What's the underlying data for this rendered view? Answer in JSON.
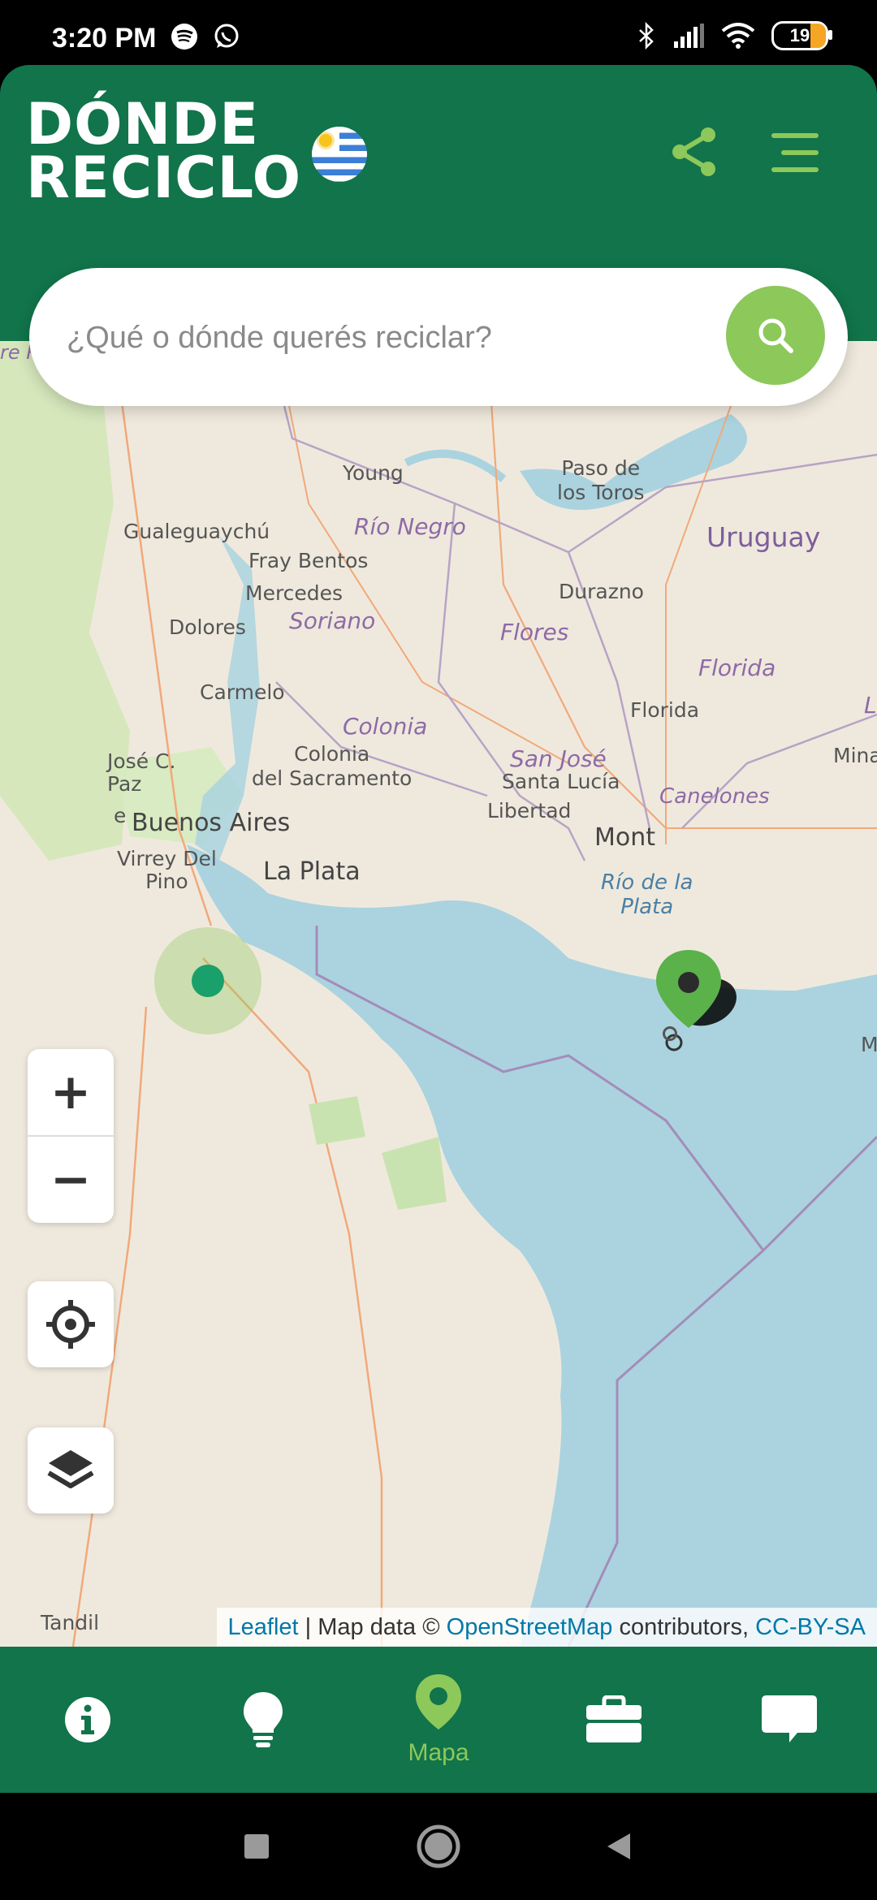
{
  "status_bar": {
    "time": "3:20 PM",
    "battery_level": "19",
    "icons": [
      "spotify-icon",
      "whatsapp-icon",
      "bluetooth-icon",
      "signal-icon",
      "wifi-icon",
      "battery-icon"
    ]
  },
  "header": {
    "brand_line1": "DÓNDE",
    "brand_line2": "RECICLO",
    "flag": "uruguay-flag",
    "colors": {
      "primary": "#11744a",
      "accent": "#8dc85a"
    }
  },
  "search": {
    "placeholder": "¿Qué o dónde querés reciclar?"
  },
  "map": {
    "labels": {
      "young": "Young",
      "paso_de_los_toros": "Paso de\nlos Toros",
      "gualeguaychu": "Gualeguaychú",
      "rio_negro": "Río Negro",
      "uruguay": "Uruguay",
      "fray_bentos": "Fray Bentos",
      "mercedes": "Mercedes",
      "durazno": "Durazno",
      "dolores": "Dolores",
      "soriano": "Soriano",
      "flores": "Flores",
      "florida_dept": "Florida",
      "carmelo": "Carmelo",
      "florida_city": "Florida",
      "colonia_dept": "Colonia",
      "colonia_city": "Colonia\ndel Sacramento",
      "jose_c_paz": "José C.\nPaz",
      "san_jose": "San José",
      "santa_lucia": "Santa Lucía",
      "mina": "Mina",
      "canelones": "Canelones",
      "libertad": "Libertad",
      "buenos_aires": "Buenos Aires",
      "montevideo": "Mont",
      "virrey_del_pino": "Virrey Del\nPino",
      "la_plata": "La Plata",
      "rio_de_la_plata": "Río de la\nPlata",
      "tandil": "Tandil",
      "edge_re": "re R",
      "edge_e": "e",
      "edge_l": "L",
      "edge_m": "M"
    },
    "attribution": {
      "leaflet": "Leaflet",
      "mid": " | Map data © ",
      "osm": "OpenStreetMap",
      "contributors": " contributors, ",
      "license": "CC-BY-SA"
    },
    "controls": {
      "zoom_in": "+",
      "zoom_out": "−"
    }
  },
  "bottom_nav": {
    "items": [
      {
        "icon": "info-icon",
        "label": ""
      },
      {
        "icon": "lightbulb-icon",
        "label": ""
      },
      {
        "icon": "map-pin-icon",
        "label": "Mapa",
        "active": true
      },
      {
        "icon": "briefcase-icon",
        "label": ""
      },
      {
        "icon": "chat-icon",
        "label": ""
      }
    ]
  }
}
